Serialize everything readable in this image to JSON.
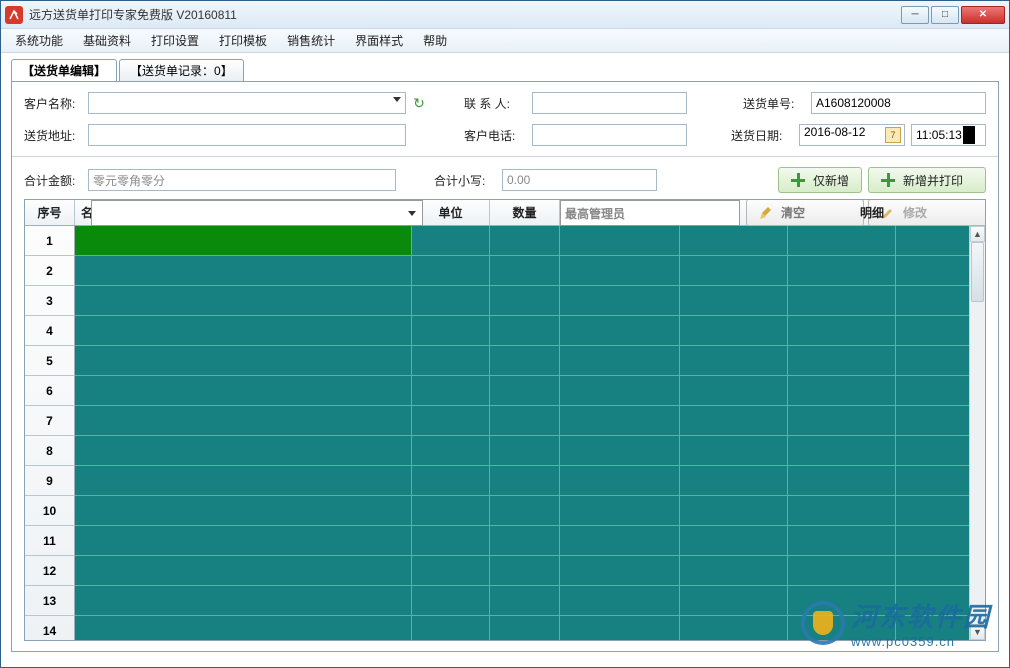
{
  "window": {
    "title": "远方送货单打印专家免费版 V20160811"
  },
  "menu": {
    "items": [
      "系统功能",
      "基础资料",
      "打印设置",
      "打印模板",
      "销售统计",
      "界面样式",
      "帮助"
    ]
  },
  "tabs": {
    "edit": "【送货单编辑】",
    "records": "【送货单记录：0】"
  },
  "form": {
    "customer_name_label": "客户名称:",
    "contact_label": "联 系 人:",
    "delivery_no_label": "送货单号:",
    "delivery_no_value": "A1608120008",
    "address_label": "送货地址:",
    "phone_label": "客户电话:",
    "delivery_date_label": "送货日期:",
    "delivery_date_value": "2016-08-12",
    "delivery_time_value": "11:05:13",
    "total_cn_label": "合计金额:",
    "total_cn_value": "零元零角零分",
    "total_num_label": "合计小写:",
    "total_num_value": "0.00"
  },
  "buttons": {
    "add_only": "仅新增",
    "add_print": "新增并打印",
    "clear": "清空",
    "modify": "修改"
  },
  "grid": {
    "headers": {
      "seq": "序号",
      "name": "名称",
      "unit": "单位",
      "qty": "数量",
      "overlay_text": "最高管理员",
      "tail": "明细"
    },
    "row_count": 14
  },
  "watermark": {
    "cn": "河东软件园",
    "url": "www.pc0359.cn"
  }
}
